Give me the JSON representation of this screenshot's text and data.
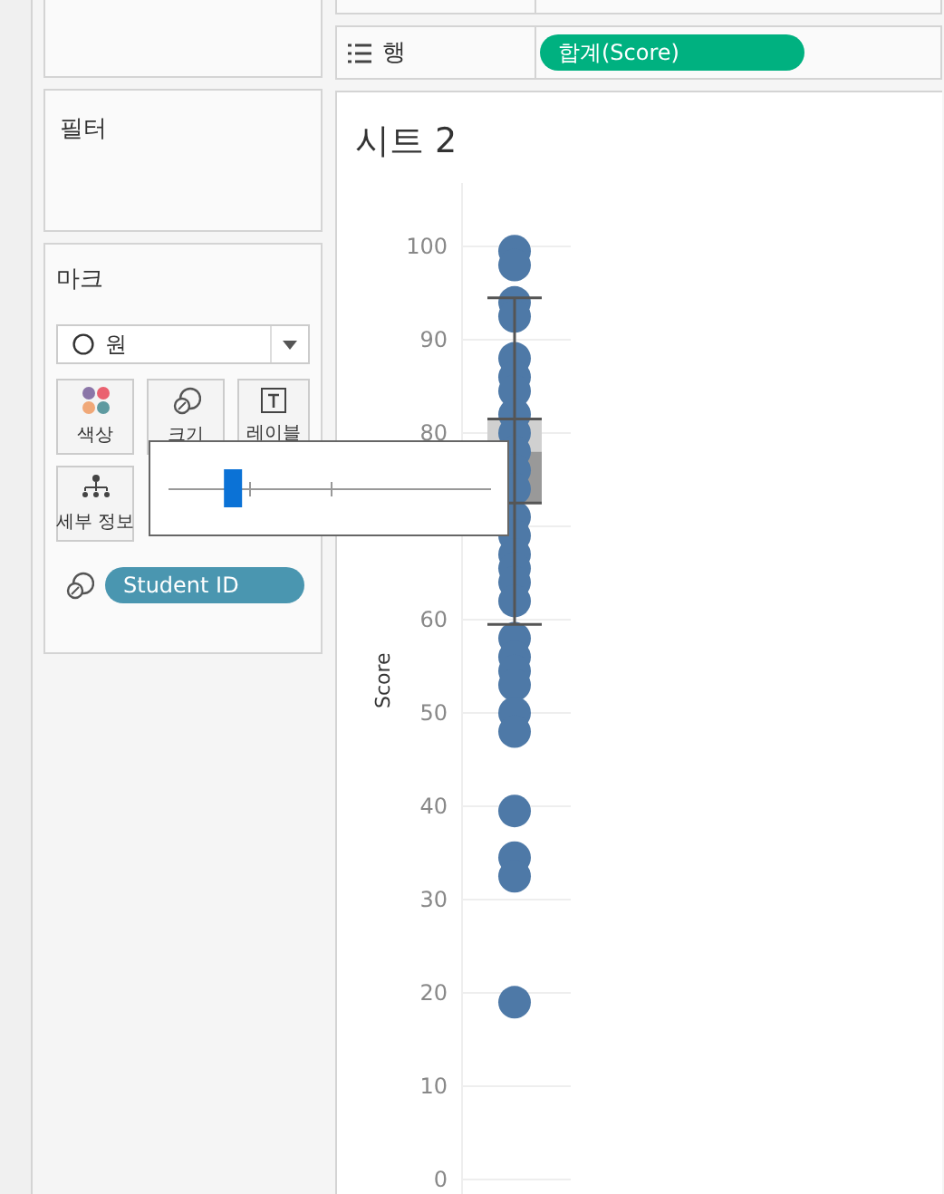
{
  "shelves": {
    "rows": {
      "label": "행",
      "pill": "합계(Score)"
    }
  },
  "filters": {
    "title": "필터"
  },
  "marks": {
    "title": "마크",
    "mark_type": "원",
    "buttons": [
      {
        "kind": "color",
        "label": "색상"
      },
      {
        "kind": "size",
        "label": "크기"
      },
      {
        "kind": "label",
        "label": "레이블"
      },
      {
        "kind": "detail",
        "label": "세부 정보"
      }
    ],
    "fields": [
      {
        "kind": "size",
        "label": "Student ID"
      }
    ]
  },
  "size_popup": {
    "level": 0.2
  },
  "sheet": {
    "title": "시트 2",
    "axis": {
      "title": "Score",
      "ticks_upper": [
        "100",
        "90",
        "80"
      ],
      "ticks_lower": [
        "60",
        "50",
        "40",
        "30",
        "20",
        "10",
        "0"
      ]
    }
  }
}
